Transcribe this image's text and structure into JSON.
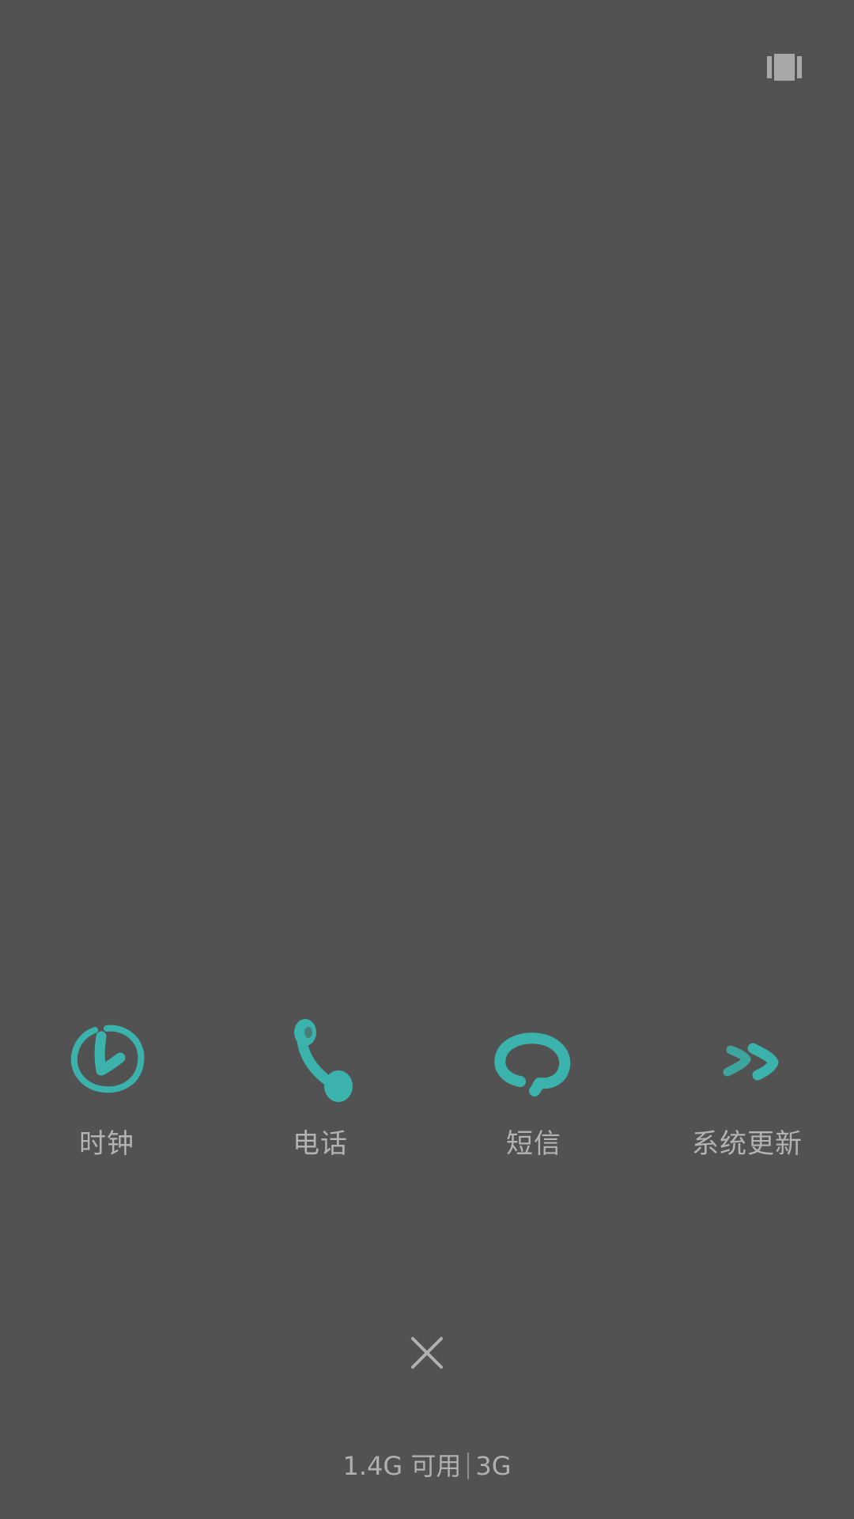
{
  "top_right": {
    "icon": "recent-apps-icon"
  },
  "apps": [
    {
      "label": "时钟",
      "icon": "clock-icon"
    },
    {
      "label": "电话",
      "icon": "phone-icon"
    },
    {
      "label": "短信",
      "icon": "message-icon"
    },
    {
      "label": "系统更新",
      "icon": "system-update-icon"
    }
  ],
  "close": {
    "icon": "close-icon"
  },
  "storage": {
    "memory": "1.4G 可用",
    "total": "3G"
  },
  "colors": {
    "background": "#525252",
    "accent": "#3bb3ac",
    "label": "#b3b3b3"
  }
}
